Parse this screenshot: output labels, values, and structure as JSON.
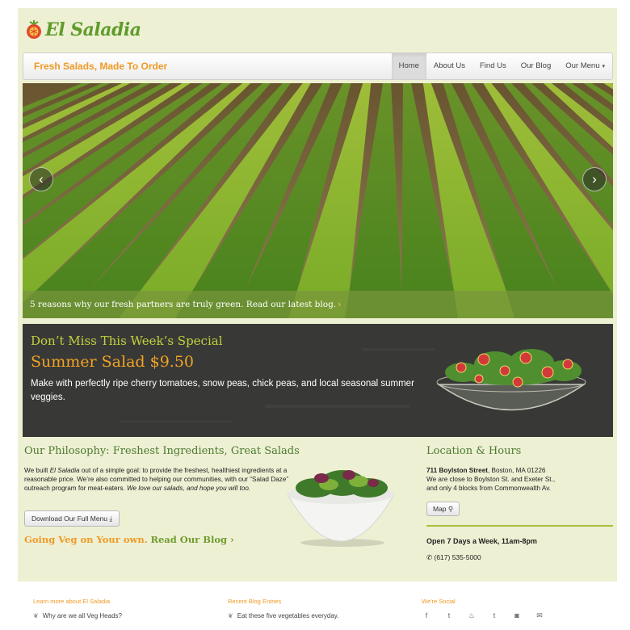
{
  "logo": {
    "text": "El Saladia"
  },
  "navbar": {
    "brand": "Fresh Salads, Made To Order",
    "items": [
      {
        "label": "Home",
        "active": true
      },
      {
        "label": "About Us"
      },
      {
        "label": "Find Us"
      },
      {
        "label": "Our Blog"
      },
      {
        "label": "Our Menu",
        "caret": "▾"
      }
    ]
  },
  "hero": {
    "prev": "‹",
    "next": "›",
    "caption": "5 reasons why our fresh partners are truly green. Read our latest blog.",
    "caption_chevron": "›"
  },
  "special": {
    "heading": "Don’t Miss This Week’s Special",
    "title": "Summer Salad $9.50",
    "description": "Make with perfectly ripe cherry tomatoes, snow peas, chick peas, and local seasonal summer veggies."
  },
  "philosophy": {
    "heading": "Our Philosophy: Freshest Ingredients, Great Salads",
    "text_1": "We built ",
    "text_brand": "El Saladia",
    "text_2": " out of a simple goal: to provide the freshest, healthiest ingredients at a reasonable price. We’re also committed to helping our communities, with our “Salad Daze” outreach program for meat-eaters. ",
    "text_italic": "We love our salads, and hope you will too.",
    "button": "Download Our Full Menu",
    "button_icon": "⤓",
    "veg_text": "Going Veg on Your own.",
    "veg_link": "Read Our Blog",
    "veg_chevron": "›"
  },
  "location": {
    "heading": "Location & Hours",
    "street": "711 Boylston Street",
    "city": ", Boston, MA 01226",
    "line2": "We are close to Boylston St. and Exeter St.,",
    "line3": "and only 4 blocks from Commonwealth Av.",
    "map_button": "Map",
    "map_icon": "⚲",
    "hours": "Open 7 Days a Week, 11am-8pm",
    "phone_icon": "✆",
    "phone": "(617) 535-5000"
  },
  "footer": {
    "learn": {
      "title": "Learn more about El Saladia",
      "link": "Why are we all Veg Heads?"
    },
    "blog": {
      "title": "Recent Blog Entries",
      "link": "Eat these five vegetables everyday."
    },
    "social": {
      "title": "We're Social",
      "icons": [
        {
          "name": "facebook-icon",
          "glyph": "f"
        },
        {
          "name": "twitter-icon",
          "glyph": "t"
        },
        {
          "name": "foursquare-icon",
          "glyph": "♨"
        },
        {
          "name": "tumblr-icon",
          "glyph": "t"
        },
        {
          "name": "instagram-icon",
          "glyph": "◙"
        },
        {
          "name": "email-icon",
          "glyph": "✉"
        }
      ]
    },
    "leaf_glyph": "❦"
  },
  "colors": {
    "page_bg": "#eef0d4",
    "brand_green": "#5f9c2a",
    "accent_orange": "#ef9a25",
    "heading_green": "#4b7b2f",
    "chalk_green": "#c4cf3c"
  }
}
